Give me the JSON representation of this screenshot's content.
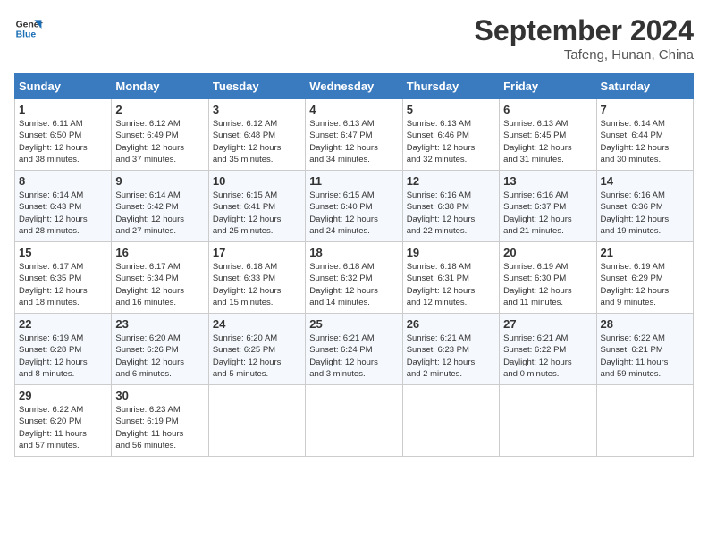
{
  "header": {
    "logo_line1": "General",
    "logo_line2": "Blue",
    "month_year": "September 2024",
    "location": "Tafeng, Hunan, China"
  },
  "weekdays": [
    "Sunday",
    "Monday",
    "Tuesday",
    "Wednesday",
    "Thursday",
    "Friday",
    "Saturday"
  ],
  "weeks": [
    [
      {
        "day": "1",
        "info": "Sunrise: 6:11 AM\nSunset: 6:50 PM\nDaylight: 12 hours\nand 38 minutes."
      },
      {
        "day": "2",
        "info": "Sunrise: 6:12 AM\nSunset: 6:49 PM\nDaylight: 12 hours\nand 37 minutes."
      },
      {
        "day": "3",
        "info": "Sunrise: 6:12 AM\nSunset: 6:48 PM\nDaylight: 12 hours\nand 35 minutes."
      },
      {
        "day": "4",
        "info": "Sunrise: 6:13 AM\nSunset: 6:47 PM\nDaylight: 12 hours\nand 34 minutes."
      },
      {
        "day": "5",
        "info": "Sunrise: 6:13 AM\nSunset: 6:46 PM\nDaylight: 12 hours\nand 32 minutes."
      },
      {
        "day": "6",
        "info": "Sunrise: 6:13 AM\nSunset: 6:45 PM\nDaylight: 12 hours\nand 31 minutes."
      },
      {
        "day": "7",
        "info": "Sunrise: 6:14 AM\nSunset: 6:44 PM\nDaylight: 12 hours\nand 30 minutes."
      }
    ],
    [
      {
        "day": "8",
        "info": "Sunrise: 6:14 AM\nSunset: 6:43 PM\nDaylight: 12 hours\nand 28 minutes."
      },
      {
        "day": "9",
        "info": "Sunrise: 6:14 AM\nSunset: 6:42 PM\nDaylight: 12 hours\nand 27 minutes."
      },
      {
        "day": "10",
        "info": "Sunrise: 6:15 AM\nSunset: 6:41 PM\nDaylight: 12 hours\nand 25 minutes."
      },
      {
        "day": "11",
        "info": "Sunrise: 6:15 AM\nSunset: 6:40 PM\nDaylight: 12 hours\nand 24 minutes."
      },
      {
        "day": "12",
        "info": "Sunrise: 6:16 AM\nSunset: 6:38 PM\nDaylight: 12 hours\nand 22 minutes."
      },
      {
        "day": "13",
        "info": "Sunrise: 6:16 AM\nSunset: 6:37 PM\nDaylight: 12 hours\nand 21 minutes."
      },
      {
        "day": "14",
        "info": "Sunrise: 6:16 AM\nSunset: 6:36 PM\nDaylight: 12 hours\nand 19 minutes."
      }
    ],
    [
      {
        "day": "15",
        "info": "Sunrise: 6:17 AM\nSunset: 6:35 PM\nDaylight: 12 hours\nand 18 minutes."
      },
      {
        "day": "16",
        "info": "Sunrise: 6:17 AM\nSunset: 6:34 PM\nDaylight: 12 hours\nand 16 minutes."
      },
      {
        "day": "17",
        "info": "Sunrise: 6:18 AM\nSunset: 6:33 PM\nDaylight: 12 hours\nand 15 minutes."
      },
      {
        "day": "18",
        "info": "Sunrise: 6:18 AM\nSunset: 6:32 PM\nDaylight: 12 hours\nand 14 minutes."
      },
      {
        "day": "19",
        "info": "Sunrise: 6:18 AM\nSunset: 6:31 PM\nDaylight: 12 hours\nand 12 minutes."
      },
      {
        "day": "20",
        "info": "Sunrise: 6:19 AM\nSunset: 6:30 PM\nDaylight: 12 hours\nand 11 minutes."
      },
      {
        "day": "21",
        "info": "Sunrise: 6:19 AM\nSunset: 6:29 PM\nDaylight: 12 hours\nand 9 minutes."
      }
    ],
    [
      {
        "day": "22",
        "info": "Sunrise: 6:19 AM\nSunset: 6:28 PM\nDaylight: 12 hours\nand 8 minutes."
      },
      {
        "day": "23",
        "info": "Sunrise: 6:20 AM\nSunset: 6:26 PM\nDaylight: 12 hours\nand 6 minutes."
      },
      {
        "day": "24",
        "info": "Sunrise: 6:20 AM\nSunset: 6:25 PM\nDaylight: 12 hours\nand 5 minutes."
      },
      {
        "day": "25",
        "info": "Sunrise: 6:21 AM\nSunset: 6:24 PM\nDaylight: 12 hours\nand 3 minutes."
      },
      {
        "day": "26",
        "info": "Sunrise: 6:21 AM\nSunset: 6:23 PM\nDaylight: 12 hours\nand 2 minutes."
      },
      {
        "day": "27",
        "info": "Sunrise: 6:21 AM\nSunset: 6:22 PM\nDaylight: 12 hours\nand 0 minutes."
      },
      {
        "day": "28",
        "info": "Sunrise: 6:22 AM\nSunset: 6:21 PM\nDaylight: 11 hours\nand 59 minutes."
      }
    ],
    [
      {
        "day": "29",
        "info": "Sunrise: 6:22 AM\nSunset: 6:20 PM\nDaylight: 11 hours\nand 57 minutes."
      },
      {
        "day": "30",
        "info": "Sunrise: 6:23 AM\nSunset: 6:19 PM\nDaylight: 11 hours\nand 56 minutes."
      },
      {
        "day": "",
        "info": ""
      },
      {
        "day": "",
        "info": ""
      },
      {
        "day": "",
        "info": ""
      },
      {
        "day": "",
        "info": ""
      },
      {
        "day": "",
        "info": ""
      }
    ]
  ]
}
